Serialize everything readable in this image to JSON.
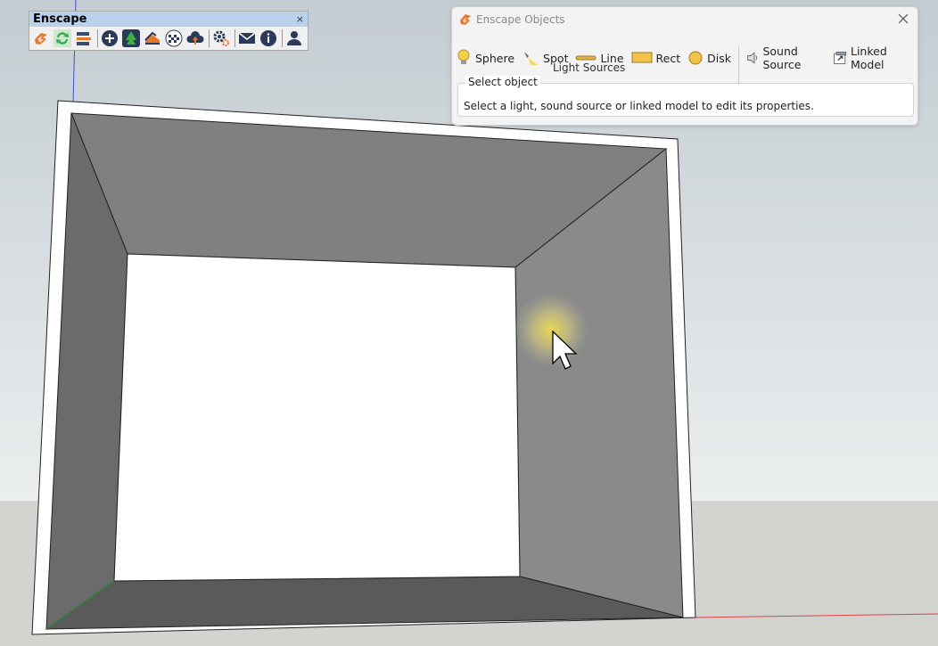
{
  "toolbar": {
    "title": "Enscape",
    "close_glyph": "×",
    "icons": [
      "enscape-start-icon",
      "sync-icon",
      "link-views-icon",
      "add-view-icon",
      "asset-library-icon",
      "material-editor-icon",
      "texture-icon",
      "upload-icon",
      "settings-icon",
      "feedback-icon",
      "info-icon",
      "account-icon"
    ]
  },
  "objects_window": {
    "title": "Enscape Objects",
    "buttons": {
      "sphere": "Sphere",
      "spot": "Spot",
      "line": "Line",
      "rect": "Rect",
      "disk": "Disk",
      "sound_source": "Sound Source",
      "linked_model": "Linked Model"
    },
    "group_label": "Light Sources",
    "select_group_label": "Select object",
    "select_message": "Select a light, sound source or linked model to edit its properties."
  },
  "colors": {
    "sky": "#cfd6da",
    "ground": "#d2d2cf",
    "accent": "#e8772e"
  }
}
